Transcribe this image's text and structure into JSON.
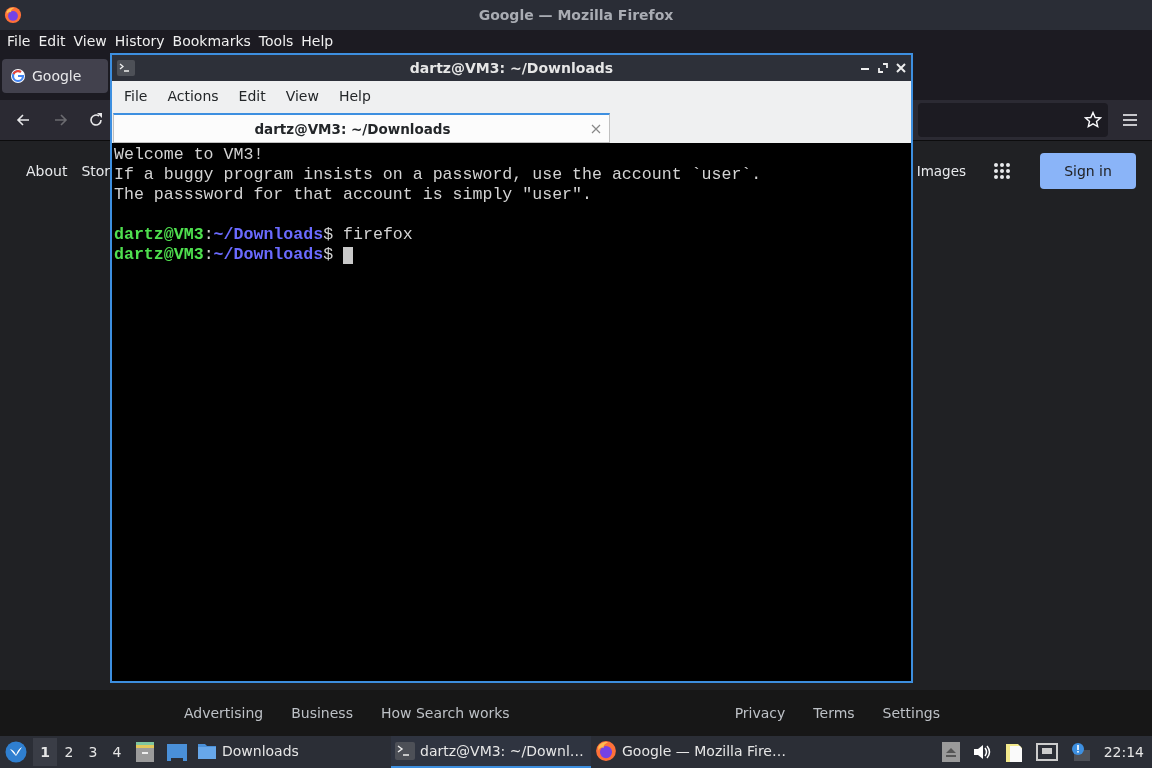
{
  "firefox": {
    "title": "Google — Mozilla Firefox",
    "menu": [
      "File",
      "Edit",
      "View",
      "History",
      "Bookmarks",
      "Tools",
      "Help"
    ],
    "tabs": [
      {
        "label": "Google",
        "selected": true
      }
    ],
    "nav_buttons": [
      {
        "kind": "back",
        "disabled": false
      },
      {
        "kind": "forward",
        "disabled": true
      },
      {
        "kind": "reload",
        "disabled": false
      }
    ],
    "page": {
      "top_links": [
        "About",
        "Stor"
      ],
      "images_link": "Images",
      "sign_in": "Sign in",
      "footer_left": [
        "Advertising",
        "Business",
        "How Search works"
      ],
      "footer_right": [
        "Privacy",
        "Terms",
        "Settings"
      ]
    }
  },
  "terminal": {
    "title": "dartz@VM3: ~/Downloads",
    "menu": [
      "File",
      "Actions",
      "Edit",
      "View",
      "Help"
    ],
    "tabs": [
      {
        "label": "dartz@VM3: ~/Downloads",
        "selected": true
      }
    ],
    "lines": [
      {
        "kind": "text",
        "text": "Welcome to VM3!"
      },
      {
        "kind": "text",
        "text": "If a buggy program insists on a password, use the account `user`."
      },
      {
        "kind": "text",
        "text": "The passsword for that account is simply \"user\"."
      },
      {
        "kind": "blank"
      },
      {
        "kind": "prompt",
        "user_host": "dartz@VM3",
        "separator": ":",
        "path": "~/Downloads",
        "symbol": "$",
        "command": "firefox"
      },
      {
        "kind": "prompt",
        "user_host": "dartz@VM3",
        "separator": ":",
        "path": "~/Downloads",
        "symbol": "$",
        "cursor": true
      }
    ]
  },
  "taskbar": {
    "workspaces": [
      {
        "label": "1",
        "selected": true
      },
      {
        "label": "2",
        "selected": false
      },
      {
        "label": "3",
        "selected": false
      },
      {
        "label": "4",
        "selected": false
      }
    ],
    "tasks": [
      {
        "kind": "folder",
        "label": "Downloads",
        "selected": false
      },
      {
        "kind": "terminal",
        "label": "dartz@VM3: ~/Downl…",
        "selected": true
      },
      {
        "kind": "firefox",
        "label": "Google — Mozilla Fire…",
        "selected": false
      }
    ],
    "clock": "22:14"
  }
}
